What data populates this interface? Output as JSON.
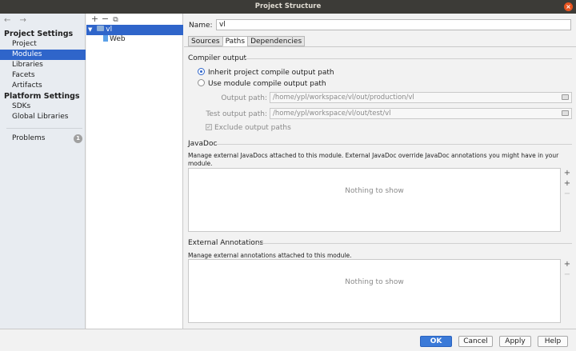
{
  "window": {
    "title": "Project Structure",
    "close_glyph": "×"
  },
  "nav": {
    "back_forward": "← →",
    "project_settings_heading": "Project Settings",
    "project_settings": [
      "Project",
      "Modules",
      "Libraries",
      "Facets",
      "Artifacts"
    ],
    "platform_settings_heading": "Platform Settings",
    "platform_settings": [
      "SDKs",
      "Global Libraries"
    ],
    "problems_label": "Problems",
    "problems_count": "1",
    "selected": "Modules"
  },
  "tree": {
    "toolbar": {
      "add": "+",
      "remove": "−",
      "copy": "⧉"
    },
    "nodes": [
      {
        "label": "vl",
        "expander": "▼",
        "icon": "module-folder-icon"
      },
      {
        "label": "Web",
        "icon": "web-facet-icon"
      }
    ]
  },
  "module": {
    "name_label": "Name:",
    "name_value": "vl",
    "tabs": [
      "Sources",
      "Paths",
      "Dependencies"
    ],
    "active_tab": "Paths"
  },
  "compiler_output": {
    "title": "Compiler output",
    "option_inherit": "Inherit project compile output path",
    "option_module": "Use module compile output path",
    "selected": "inherit",
    "output_label": "Output path:",
    "output_value": "/home/ypl/workspace/vl/out/production/vl",
    "test_label": "Test output path:",
    "test_value": "/home/ypl/workspace/vl/out/test/vl",
    "exclude_label": "Exclude output paths",
    "exclude_checked": true
  },
  "javadoc": {
    "title": "JavaDoc",
    "description": "Manage external JavaDocs attached to this module. External JavaDoc override JavaDoc annotations you might have in your module.",
    "empty_text": "Nothing to show",
    "tools": {
      "add": "+",
      "add_url": "+",
      "remove": "−"
    }
  },
  "external_annotations": {
    "title": "External Annotations",
    "description": "Manage external annotations attached to this module.",
    "empty_text": "Nothing to show",
    "tools": {
      "add": "+",
      "remove": "−"
    }
  },
  "buttons": {
    "ok": "OK",
    "cancel": "Cancel",
    "apply": "Apply",
    "help": "Help"
  },
  "colors": {
    "selection": "#2f65ca",
    "primary_button": "#3b7ad8",
    "titlebar": "#3c3b37",
    "close": "#e9541f"
  }
}
